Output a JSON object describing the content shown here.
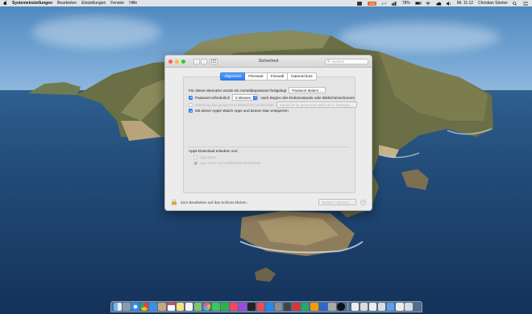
{
  "menubar": {
    "apple": "",
    "items": [
      "Systemeinstellungen",
      "Bearbeiten",
      "Einstellungen",
      "Fenster",
      "Hilfe"
    ],
    "status_badge": "100",
    "battery": "78%",
    "clock": "Mi. 11:12",
    "user": "Christian Steiner"
  },
  "window": {
    "title": "Sicherheit",
    "search_placeholder": "Suchen",
    "tabs": [
      "Allgemein",
      "FileVault",
      "Firewall",
      "Datenschutz"
    ],
    "active_tab": "Allgemein",
    "login_password_text": "Für diesen Benutzer wurde ein Anmeldepasswort festgelegt",
    "change_password_button": "Passwort ändern ...",
    "require_password_label": "Passwort erforderlich",
    "require_password_delay": "5 Minuten",
    "require_password_suffix": "nach Beginn des Ruhezustands oder Bildschirmschoners",
    "lock_message_label": "Mitteilung bei gesperrtem Bildschirm einblenden",
    "lock_message_button": "Nachricht für gesperrten Bildschirm festlegen ...",
    "apple_watch_label": "Mit deiner Apple Watch Apps und deinen Mac entsperren",
    "downloads_heading": "Apps-Download erlauben von:",
    "download_options": [
      "App Store",
      "App Store und verifizierten Entwickler"
    ],
    "lock_text": "Zum Bearbeiten auf das Schloss klicken.",
    "advanced_button": "Weitere Optionen ...",
    "help_label": "?"
  },
  "colors": {
    "accent": "#2f7cf0",
    "window_bg": "#ececec"
  },
  "dock": {
    "icons": [
      "finder-icon",
      "launchpad-icon",
      "safari-icon",
      "chrome-icon",
      "mail-icon",
      "contacts-icon",
      "calendar-icon",
      "notes-icon",
      "reminders-icon",
      "maps-icon",
      "photos-icon",
      "messages-icon",
      "facetime-icon",
      "music-icon",
      "podcasts-icon",
      "tv-icon",
      "news-icon",
      "appstore-icon",
      "settings-icon",
      "app-icon",
      "app-icon",
      "app-icon",
      "app-icon",
      "app-icon",
      "app-icon",
      "app-icon",
      "app-icon",
      "app-icon",
      "app-icon",
      "app-icon",
      "downloads-icon",
      "folder-icon",
      "trash-icon"
    ]
  }
}
